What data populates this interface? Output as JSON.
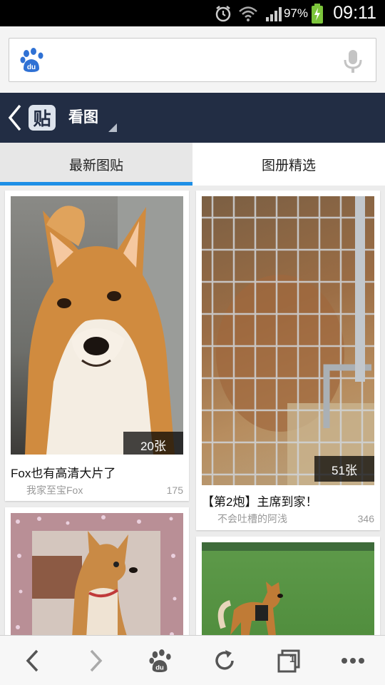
{
  "status_bar": {
    "battery_percent": "97%",
    "time": "09:11"
  },
  "search": {
    "placeholder": "",
    "value": ""
  },
  "nav": {
    "logo_glyph": "贴",
    "title": "看图"
  },
  "tabs": [
    {
      "label": "最新图贴",
      "active": true
    },
    {
      "label": "图册精选",
      "active": false
    }
  ],
  "posts": [
    {
      "title": "Fox也有高清大片了",
      "author": "我家至宝Fox",
      "replies": "175",
      "photo_count": "20张",
      "photo_subject": "shiba-inu-portrait"
    },
    {
      "title": "【第2炮】主席到家！",
      "author": "不会吐槽的阿浅",
      "replies": "346",
      "photo_count": "51张",
      "photo_subject": "dog-behind-cage"
    },
    {
      "title": "",
      "author": "",
      "replies": "",
      "photo_count": "",
      "photo_subject": "shiba-with-sparkle-border"
    },
    {
      "title": "",
      "author": "",
      "replies": "",
      "photo_count": "",
      "photo_subject": "shiba-on-grass"
    }
  ],
  "colors": {
    "nav_background": "#222d44",
    "tab_indicator": "#1e8fe6",
    "baidu_blue": "#2f71d4"
  },
  "icons": {
    "status": [
      "alarm-icon",
      "wifi-icon",
      "signal-icon",
      "battery-charging-icon"
    ],
    "bottom_bar": [
      "back-icon",
      "forward-icon",
      "baidu-home-icon",
      "refresh-icon",
      "tabs-icon",
      "more-icon"
    ]
  },
  "bottom_bar": {
    "tab_count": "1"
  }
}
